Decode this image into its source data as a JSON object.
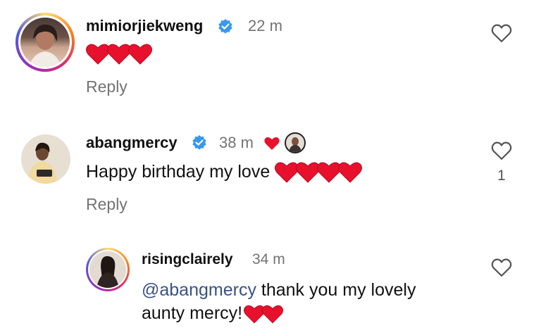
{
  "comments": [
    {
      "username": "mimiorjiekweng",
      "verified": true,
      "time": "22 m",
      "text": "",
      "emoji_hearts": 3,
      "reply_label": "Reply",
      "likes": ""
    },
    {
      "username": "abangmercy",
      "verified": true,
      "time": "38 m",
      "text": "Happy birthday my love ",
      "emoji_hearts": 4,
      "reply_label": "Reply",
      "likes": "1"
    }
  ],
  "reply": {
    "username": "risingclairely",
    "time": "34 m",
    "mention": "@abangmercy",
    "text_line1": " thank you my lovely",
    "text_line2": "aunty mercy!",
    "emoji_hearts": 2
  },
  "colors": {
    "heart_red": "#e8112d",
    "verified_blue": "#3897f0",
    "meta_gray": "#737373",
    "mention_blue": "#385185"
  }
}
